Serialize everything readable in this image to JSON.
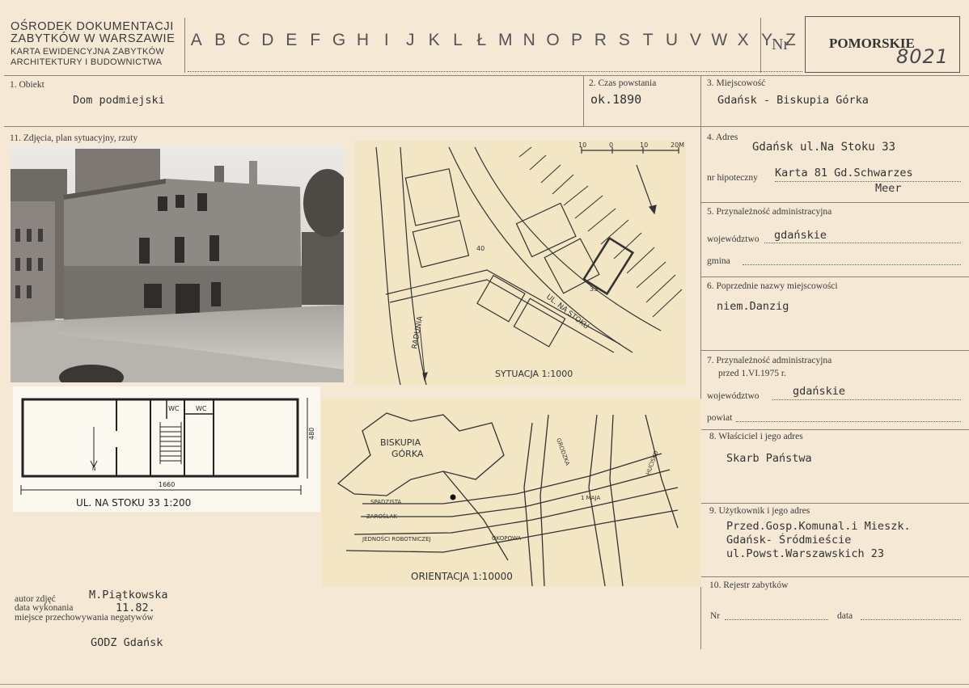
{
  "header": {
    "institution_lines": [
      "OŚRODEK DOKUMENTACJI",
      "ZABYTKÓW W WARSZAWIE",
      "KARTA EWIDENCYJNA ZABYTKÓW",
      "ARCHITEKTURY I BUDOWNICTWA"
    ],
    "letters": [
      "A",
      "B",
      "C",
      "D",
      "E",
      "F",
      "G",
      "H",
      "I",
      "J",
      "K",
      "L",
      "Ł",
      "M",
      "N",
      "O",
      "P",
      "R",
      "S",
      "T",
      "U",
      "V",
      "W",
      "X",
      "Y",
      "Z"
    ],
    "nr_label": "Nr",
    "region": "POMORSKIE",
    "card_number": "8021"
  },
  "fields": {
    "obiekt": {
      "label": "1. Obiekt",
      "value": "Dom podmiejski"
    },
    "czas_powstania": {
      "label": "2. Czas powstania",
      "value": "ok.1890"
    },
    "miejscowosc": {
      "label": "3. Miejscowość",
      "value": "Gdańsk - Biskupia Górka"
    },
    "adres": {
      "label": "4. Adres",
      "value": "Gdańsk ul.Na Stoku 33"
    },
    "nr_hipoteczny": {
      "label": "nr hipoteczny",
      "value_line1": "Karta 81 Gd.Schwarzes",
      "value_line2": "Meer"
    },
    "przynaleznosc": {
      "label": "5. Przynależność administracyjna",
      "wojewodztwo_label": "województwo",
      "wojewodztwo_value": "gdańskie",
      "gmina_label": "gmina"
    },
    "poprzednie_nazwy": {
      "label": "6. Poprzednie nazwy miejscowości",
      "value": "niem.Danzig"
    },
    "przynaleznosc_przed": {
      "label_line1": "7. Przynależność administracyjna",
      "label_line2": "przed 1.VI.1975 r.",
      "wojewodztwo_label": "województwo",
      "wojewodztwo_value": "gdańskie",
      "powiat_label": "powiat"
    },
    "wlasciciel": {
      "label": "8. Właściciel i jego adres",
      "value": "Skarb Państwa"
    },
    "uzytkownik": {
      "label": "9. Użytkownik i jego adres",
      "line1": "Przed.Gosp.Komunal.i Mieszk.",
      "line2": "Gdańsk- Śródmieście",
      "line3": "ul.Powst.Warszawskich 23"
    },
    "rejestr": {
      "label": "10. Rejestr zabytków",
      "nr_label": "Nr",
      "data_label": "data"
    },
    "zdjecia": {
      "label": "11. Zdjęcia, plan sytuacyjny, rzuty"
    }
  },
  "plans": {
    "situation_caption": "SYTUACJA 1:1000",
    "scale_ticks": [
      "10",
      "0",
      "10",
      "20M"
    ],
    "street_label": "UL. NA STOKU",
    "river_label": "RADUNIA",
    "plot_labels": [
      "40",
      "33"
    ],
    "floor_caption": "UL. NA STOKU 33  1:200",
    "floor_dims": [
      "1660",
      "480"
    ],
    "floor_rooms": [
      "WC",
      "WC"
    ],
    "orient_caption": "ORIENTACJA 1:10000",
    "orient_area": [
      "BISKUPIA",
      "GÓRKA"
    ],
    "orient_streets": [
      "HUCISKO",
      "1 MAJA",
      "OKOPOWA",
      "JEDNOŚCI ROBOTNICZEJ",
      "ZAROŚLAK",
      "SPADZISTA",
      "GRODZKA"
    ]
  },
  "footer": {
    "autor_label": "autor zdjęć",
    "autor_value": "M.Piątkowska",
    "data_label": "data wykonania",
    "data_value": "11.82.",
    "miejsce_label": "miejsce przechowywania negatywów",
    "miejsce_value": "GODZ Gdańsk"
  }
}
